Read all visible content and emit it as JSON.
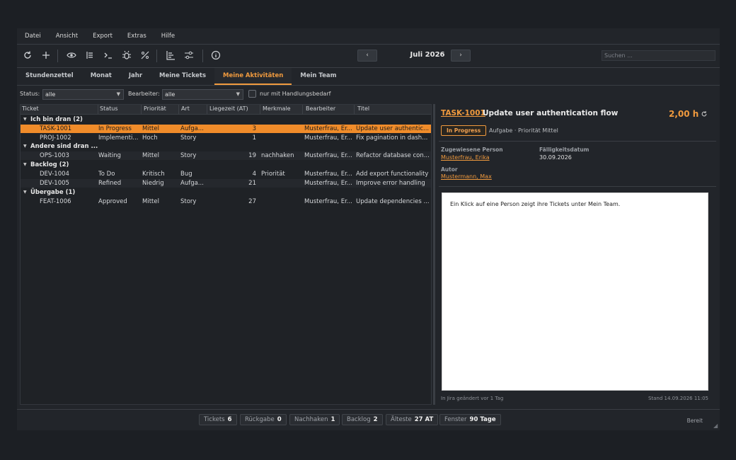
{
  "menu": [
    "Datei",
    "Ansicht",
    "Export",
    "Extras",
    "Hilfe"
  ],
  "toolbar": {
    "icons": [
      "refresh-icon",
      "add-icon",
      "eye-icon",
      "list-icon",
      "terminal-icon",
      "bug-icon",
      "percent-icon",
      "gantt-icon",
      "sliders-icon",
      "info-icon"
    ],
    "month": "Juli 2026",
    "prev": "‹",
    "next": "›",
    "search_placeholder": "Suchen ..."
  },
  "tabs": [
    {
      "label": "Stundenzettel",
      "active": false
    },
    {
      "label": "Monat",
      "active": false
    },
    {
      "label": "Jahr",
      "active": false
    },
    {
      "label": "Meine Tickets",
      "active": false
    },
    {
      "label": "Meine Aktivitäten",
      "active": true
    },
    {
      "label": "Mein Team",
      "active": false
    }
  ],
  "filters": {
    "status_label": "Status:",
    "status_value": "alle",
    "assignee_label": "Bearbeiter:",
    "assignee_value": "alle",
    "checkbox_label": "nur mit Handlungsbedarf"
  },
  "table": {
    "columns": [
      "Ticket",
      "Status",
      "Priorität",
      "Art",
      "Liegezeit (AT)",
      "Merkmale",
      "Bearbeiter",
      "Titel"
    ],
    "groups": [
      {
        "label": "Ich bin dran  (2)",
        "rows": [
          {
            "ticket": "TASK-1001",
            "status": "In Progress",
            "priority": "Mittel",
            "type": "Aufga...",
            "age": "3",
            "flags": "",
            "assignee": "Musterfrau, Er...",
            "title": "Update user authentic...",
            "selected": true
          },
          {
            "ticket": "PROJ-1002",
            "status": "Implementi...",
            "priority": "Hoch",
            "type": "Story",
            "age": "1",
            "flags": "",
            "assignee": "Musterfrau, Er...",
            "title": "Fix pagination in dash...",
            "selected": false
          }
        ]
      },
      {
        "label": "Andere sind dran ...",
        "rows": [
          {
            "ticket": "OPS-1003",
            "status": "Waiting",
            "priority": "Mittel",
            "type": "Story",
            "age": "19",
            "flags": "nachhaken",
            "assignee": "Musterfrau, Er...",
            "title": "Refactor database con...",
            "selected": false
          }
        ]
      },
      {
        "label": "Backlog  (2)",
        "rows": [
          {
            "ticket": "DEV-1004",
            "status": "To Do",
            "priority": "Kritisch",
            "type": "Bug",
            "age": "4",
            "flags": "Priorität",
            "assignee": "Musterfrau, Er...",
            "title": "Add export functionality",
            "selected": false
          },
          {
            "ticket": "DEV-1005",
            "status": "Refined",
            "priority": "Niedrig",
            "type": "Aufga...",
            "age": "21",
            "flags": "",
            "assignee": "Musterfrau, Er...",
            "title": "Improve error handling",
            "selected": false
          }
        ]
      },
      {
        "label": "Übergabe  (1)",
        "rows": [
          {
            "ticket": "FEAT-1006",
            "status": "Approved",
            "priority": "Mittel",
            "type": "Story",
            "age": "27",
            "flags": "",
            "assignee": "Musterfrau, Er...",
            "title": "Update dependencies ...",
            "selected": false
          }
        ]
      }
    ]
  },
  "detail": {
    "key": "TASK-1001",
    "title": "Update user authentication flow",
    "hours": "2,00 h",
    "badge": "In Progress",
    "meta": "Aufgabe · Priorität Mittel",
    "assignee_label": "Zugewiesene Person",
    "assignee": "Musterfrau, Erika",
    "due_label": "Fälligkeitsdatum",
    "due": "30.09.2026",
    "author_label": "Autor",
    "author": "Mustermann, Max",
    "note": "Ein Klick auf eine Person zeigt ihre Tickets unter Mein Team.",
    "changed": "In Jira geändert vor 1 Tag",
    "stand": "Stand 14.09.2026 11:05"
  },
  "statusbar": {
    "pills": [
      {
        "label": "Tickets",
        "value": "6"
      },
      {
        "label": "Rückgabe",
        "value": "0"
      },
      {
        "label": "Nachhaken",
        "value": "1"
      },
      {
        "label": "Backlog",
        "value": "2"
      },
      {
        "label": "Älteste",
        "value": "27 AT"
      },
      {
        "label": "Fenster",
        "value": "90 Tage"
      }
    ],
    "ready": "Bereit"
  },
  "colors": {
    "accent": "#f09a3e",
    "selected_row": "#f08c2a"
  }
}
